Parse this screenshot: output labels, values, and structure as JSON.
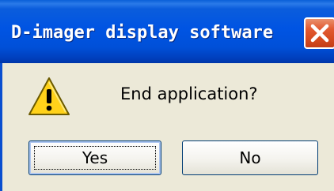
{
  "window": {
    "title": "D-imager display software",
    "close_icon": "close-icon"
  },
  "content": {
    "icon": "warning-icon",
    "message": "End application?"
  },
  "buttons": {
    "yes_label": "Yes",
    "no_label": "No"
  },
  "colors": {
    "titlebar": "#0054e3",
    "close_button": "#d64b20",
    "dialog_background": "#ece9d8",
    "warning_fill": "#ffd21a"
  }
}
